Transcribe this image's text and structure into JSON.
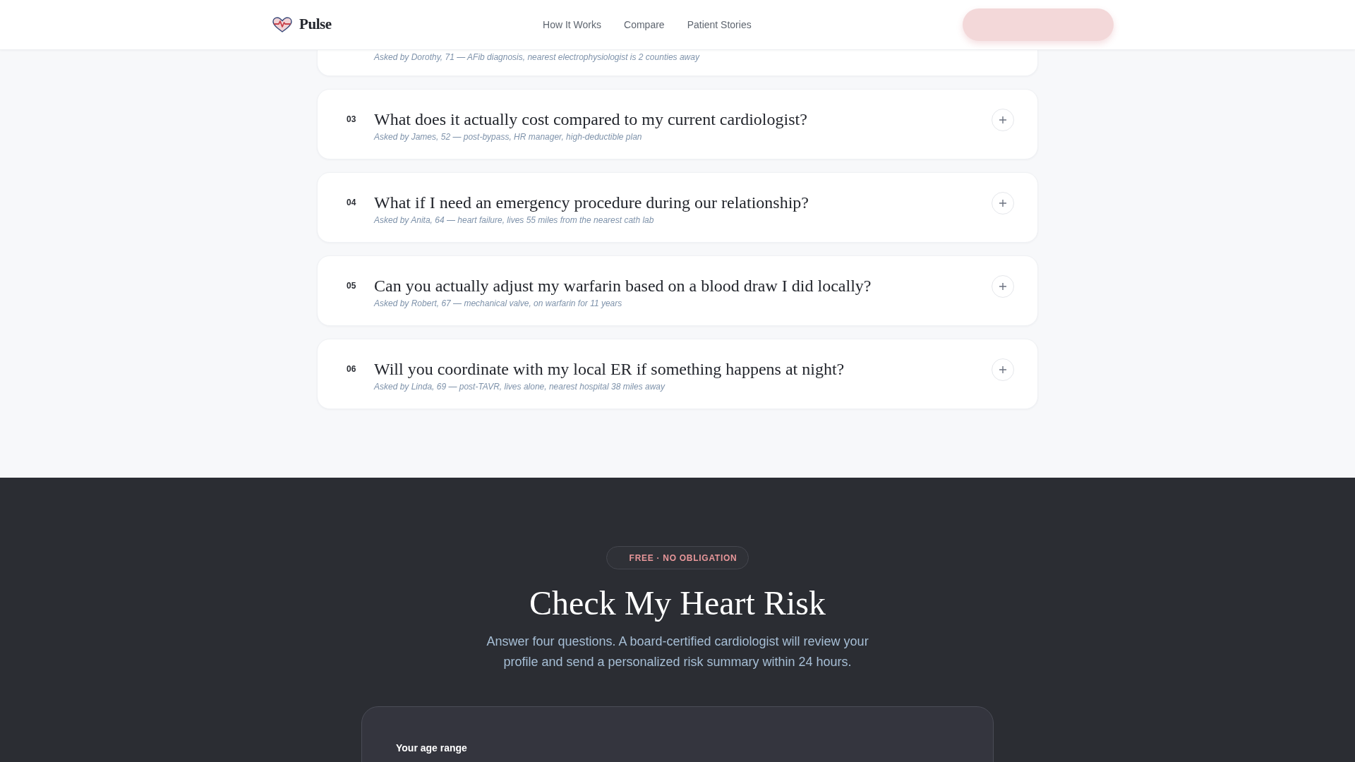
{
  "header": {
    "brand": "Pulse",
    "nav": [
      {
        "label": "How It Works"
      },
      {
        "label": "Compare"
      },
      {
        "label": "Patient Stories"
      }
    ]
  },
  "faq": {
    "items": [
      {
        "asked": "Asked by Dorothy, 71 — AFib diagnosis, nearest electrophysiologist is 2 counties away"
      },
      {
        "number": "03",
        "question": "What does it actually cost compared to my current cardiologist?",
        "asked": "Asked by James, 52 — post-bypass, HR manager, high-deductible plan",
        "expanded": false
      },
      {
        "number": "04",
        "question": "What if I need an emergency procedure during our relationship?",
        "asked": "Asked by Anita, 64 — heart failure, lives 55 miles from the nearest cath lab",
        "expanded": false
      },
      {
        "number": "05",
        "question": "Can you actually adjust my warfarin based on a blood draw I did locally?",
        "asked": "Asked by Robert, 67 — mechanical valve, on warfarin for 11 years",
        "expanded": false
      },
      {
        "number": "06",
        "question": "Will you coordinate with my local ER if something happens at night?",
        "asked": "Asked by Linda, 69 — post-TAVR, lives alone, nearest hospital 38 miles away",
        "expanded": false
      }
    ]
  },
  "risk_check": {
    "badge": "FREE · NO OBLIGATION",
    "title": "Check My Heart Risk",
    "description": "Answer four questions. A board-certified cardiologist will review your profile and send a personalized risk summary within 24 hours.",
    "form": {
      "fields": [
        {
          "label": "Your age range"
        }
      ]
    }
  }
}
